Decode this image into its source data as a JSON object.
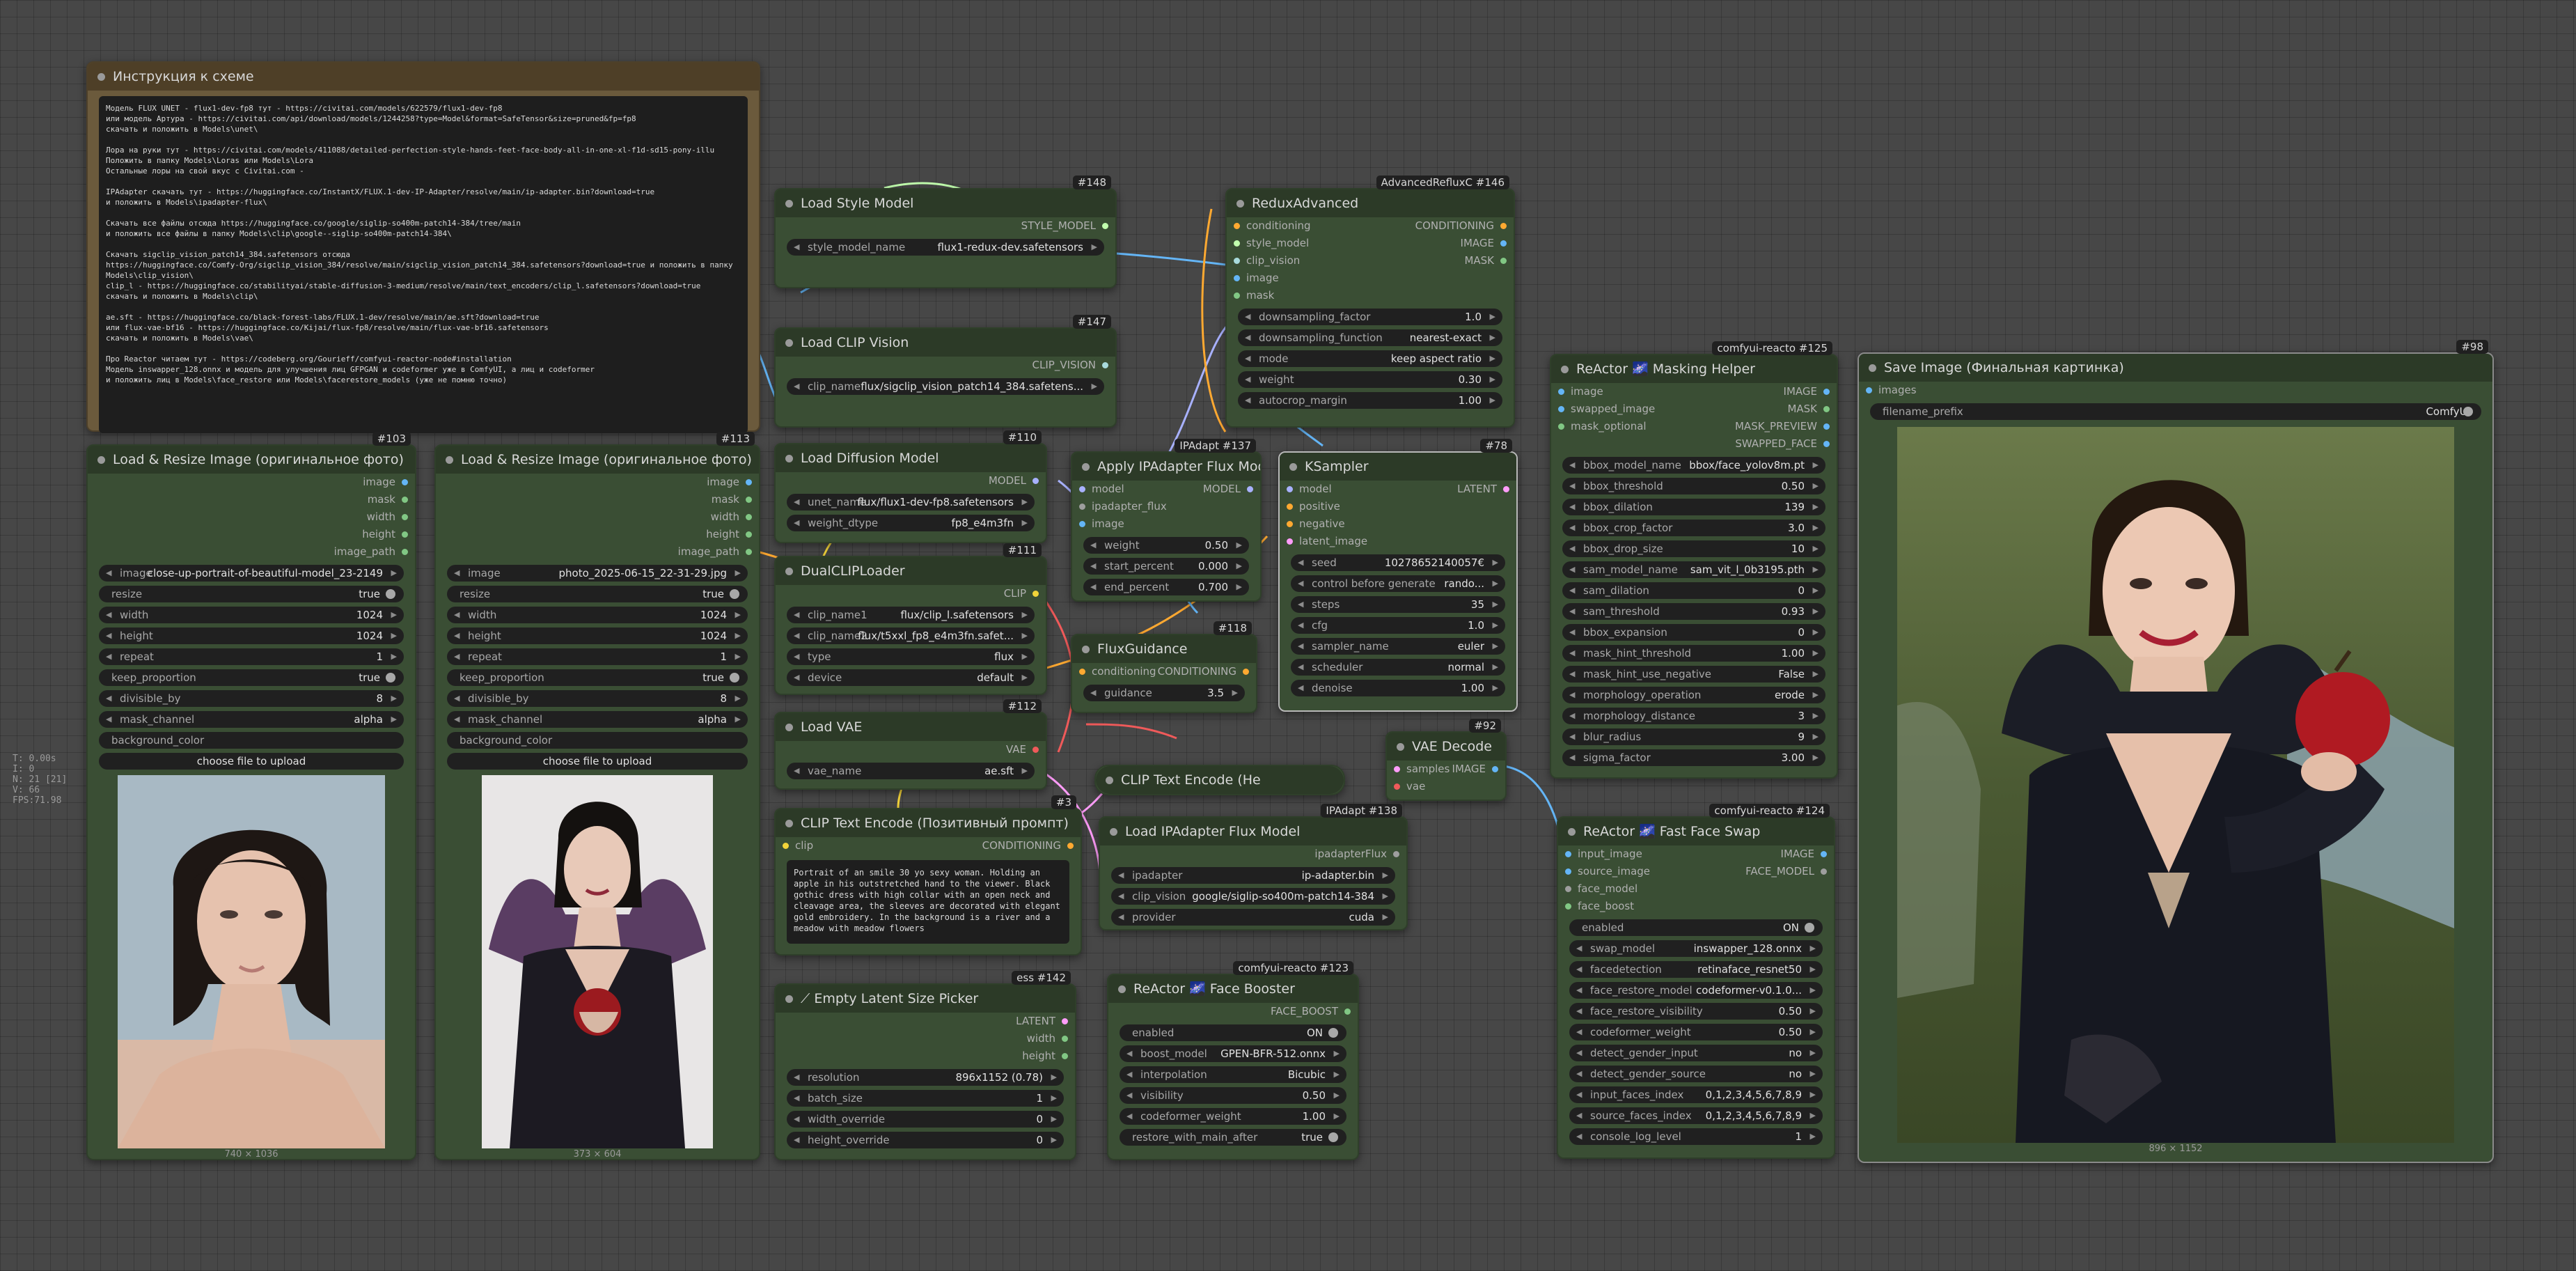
{
  "stats": [
    "T: 0.00s",
    "I: 0",
    "N: 21 [21]",
    "V: 66",
    "FPS:71.98"
  ],
  "colors": {
    "background": "#474747",
    "node_body": "#3a4e34",
    "node_title": "#2c3a27",
    "note_body": "#6b5a3c",
    "clip": "#f2d33a",
    "vae": "#ef5a5a",
    "model": "#a8b1ff",
    "conditioning": "#ffa931",
    "image": "#64b5f6",
    "mask": "#81c784",
    "latent": "#ff9cf9",
    "style_model": "#c2ffae"
  },
  "note": {
    "title": "Инструкция к схеме",
    "text": "Модель FLUX UNET - flux1-dev-fp8 тут - https://civitai.com/models/622579/flux1-dev-fp8\nили модель Артура - https://civitai.com/api/download/models/1244258?type=Model&format=SafeTensor&size=pruned&fp=fp8\nскачать и положить в Models\\unet\\\n\nЛора на руки тут - https://civitai.com/models/411088/detailed-perfection-style-hands-feet-face-body-all-in-one-xl-f1d-sd15-pony-illu\nПоложить в папку Models\\Loras или Models\\Lora\nОстальные лоры на свой вкус с Civitai.com -\n\nIPAdapter скачать тут - https://huggingface.co/InstantX/FLUX.1-dev-IP-Adapter/resolve/main/ip-adapter.bin?download=true\nи положить в Models\\ipadapter-flux\\\n\nСкачать все файлы отсюда https://huggingface.co/google/siglip-so400m-patch14-384/tree/main\nи положить все файлы в папку Models\\clip\\google--siglip-so400m-patch14-384\\\n\nСкачать sigclip_vision_patch14_384.safetensors отсюда\nhttps://huggingface.co/Comfy-Org/sigclip_vision_384/resolve/main/sigclip_vision_patch14_384.safetensors?download=true и положить в папку\nModels\\clip_vision\\\nclip_l - https://huggingface.co/stabilityai/stable-diffusion-3-medium/resolve/main/text_encoders/clip_l.safetensors?download=true\nскачать и положить в Models\\clip\\\n\nae.sft - https://huggingface.co/black-forest-labs/FLUX.1-dev/resolve/main/ae.sft?download=true\nили flux-vae-bf16 - https://huggingface.co/Kijai/flux-fp8/resolve/main/flux-vae-bf16.safetensors\nскачать и положить в Models\\vae\\\n\nПро Reactor читаем тут - https://codeberg.org/Gourieff/comfyui-reactor-node#installation\nМодель inswapper_128.onnx и модель для улучшения лиц GFPGAN и codeformer уже в ComfyUI, а лиц и codeformer\nи положить лиц в Models\\face_restore или Models\\facerestore_models (уже не помню точно)"
  },
  "load_resize_1": {
    "title": "Load & Resize Image (оригинальное фото)",
    "badge": "#103",
    "outputs": [
      "image",
      "mask",
      "width",
      "height",
      "image_path"
    ],
    "image": "close-up-portrait-of-beautiful-model_23-2149",
    "resize": "true",
    "width": "1024",
    "height": "1024",
    "repeat": "1",
    "keep_proportion": "true",
    "divisible_by": "8",
    "mask_channel": "alpha",
    "background_color": "background_color",
    "upload": "choose file to upload",
    "size_caption": "740 × 1036"
  },
  "load_resize_2": {
    "title": "Load & Resize Image (оригинальное фото)",
    "badge": "#113",
    "outputs": [
      "image",
      "mask",
      "width",
      "height",
      "image_path"
    ],
    "image": "photo_2025-06-15_22-31-29.jpg",
    "resize": "true",
    "width": "1024",
    "height": "1024",
    "repeat": "1",
    "keep_proportion": "true",
    "divisible_by": "8",
    "mask_channel": "alpha",
    "background_color": "background_color",
    "upload": "choose file to upload",
    "size_caption": "373 × 604"
  },
  "style_model": {
    "title": "Load Style Model",
    "badge": "#148",
    "output": "STYLE_MODEL",
    "label": "style_model_name",
    "value": "flux1-redux-dev.safetensors"
  },
  "clip_vision": {
    "title": "Load CLIP Vision",
    "badge": "#147",
    "output": "CLIP_VISION",
    "label": "clip_name",
    "value": "flux/sigclip_vision_patch14_384.safetens..."
  },
  "diffusion": {
    "title": "Load Diffusion Model",
    "badge": "#110",
    "output": "MODEL",
    "unet_label": "unet_name",
    "unet_value": "flux/flux1-dev-fp8.safetensors",
    "dtype_label": "weight_dtype",
    "dtype_value": "fp8_e4m3fn"
  },
  "dualclip": {
    "title": "DualCLIPLoader",
    "badge": "#111",
    "output": "CLIP",
    "clip1": "flux/clip_l.safetensors",
    "clip2": "flux/t5xxl_fp8_e4m3fn.safet...",
    "type": "flux",
    "device": "default"
  },
  "vae_loader": {
    "title": "Load VAE",
    "badge": "#112",
    "output": "VAE",
    "label": "vae_name",
    "value": "ae.sft"
  },
  "clip_text_pos": {
    "title": "CLIP Text Encode (Позитивный промпт)",
    "badge": "#3",
    "input": "clip",
    "output": "CONDITIONING",
    "text": "Portrait of an smile 30 yo sexy woman. Holding an apple in his outstretched hand to the viewer. Black gothic dress with high collar with an open neck and cleavage area, the sleeves are decorated with elegant gold embroidery. In the background is a river and a meadow with meadow flowers"
  },
  "latent_picker": {
    "title": "Empty Latent Size Picker",
    "badge": "#142",
    "badge_extra": "ess",
    "outputs": [
      "LATENT",
      "width",
      "height"
    ],
    "resolution": "896x1152 (0.78)",
    "batch_size": "1",
    "width_override": "0",
    "height_override": "0"
  },
  "redux": {
    "title": "ReduxAdvanced",
    "badge": "#146",
    "badge_extra": "AdvancedRefluxC",
    "inputs": [
      "conditioning",
      "style_model",
      "clip_vision",
      "image",
      "mask"
    ],
    "outputs": [
      "CONDITIONING",
      "IMAGE",
      "MASK"
    ],
    "downsampling_factor": "1.0",
    "downsampling_function": "nearest-exact",
    "mode": "keep aspect ratio",
    "weight": "0.30",
    "autocrop_margin": "1.00"
  },
  "apply_ipadapter": {
    "title": "Apply IPAdapter Flux Model",
    "badge": "#137",
    "badge_extra": "IPAdapt",
    "inputs": [
      "model",
      "ipadapter_flux",
      "image"
    ],
    "output": "MODEL",
    "weight": "0.50",
    "start_percent": "0.000",
    "end_percent": "0.700"
  },
  "flux_guidance": {
    "title": "FluxGuidance",
    "badge": "#118",
    "input": "conditioning",
    "output": "CONDITIONING",
    "guidance": "3.5"
  },
  "ksampler": {
    "title": "KSampler",
    "badge": "#78",
    "inputs": [
      "model",
      "positive",
      "negative",
      "latent_image"
    ],
    "output": "LATENT",
    "seed": "10278652140057€",
    "control": "rando...",
    "steps": "35",
    "cfg": "1.0",
    "sampler_name": "euler",
    "scheduler": "normal",
    "denoise": "1.00"
  },
  "vae_decode": {
    "title": "VAE Decode",
    "badge": "#92",
    "inputs": [
      "samples",
      "vae"
    ],
    "output": "IMAGE"
  },
  "clip_text_he": {
    "title": "CLIP Text Encode (He"
  },
  "load_ipadapter": {
    "title": "Load IPAdapter Flux Model",
    "badge": "#138",
    "badge_extra": "IPAdapt",
    "output": "ipadapterFlux",
    "ipadapter": "ip-adapter.bin",
    "clip_vision": "google/siglip-so400m-patch14-384",
    "provider": "cuda"
  },
  "face_booster": {
    "title": "ReActor 🌌 Face Booster",
    "badge": "#123",
    "badge_extra": "comfyui-reacto",
    "output": "FACE_BOOST",
    "enabled": "ON",
    "boost_model": "GPEN-BFR-512.onnx",
    "interpolation": "Bicubic",
    "visibility": "0.50",
    "codeformer_weight": "1.00",
    "restore_with_main_after": "true"
  },
  "masking_helper": {
    "title": "ReActor 🌌 Masking Helper",
    "badge": "#125",
    "badge_extra": "comfyui-reacto",
    "inputs": [
      "image",
      "swapped_image",
      "mask_optional"
    ],
    "outputs": [
      "IMAGE",
      "MASK",
      "MASK_PREVIEW",
      "SWAPPED_FACE"
    ],
    "rows": [
      [
        "bbox_model_name",
        "bbox/face_yolov8m.pt"
      ],
      [
        "bbox_threshold",
        "0.50"
      ],
      [
        "bbox_dilation",
        "139"
      ],
      [
        "bbox_crop_factor",
        "3.0"
      ],
      [
        "bbox_drop_size",
        "10"
      ],
      [
        "sam_model_name",
        "sam_vit_l_0b3195.pth"
      ],
      [
        "sam_dilation",
        "0"
      ],
      [
        "sam_threshold",
        "0.93"
      ],
      [
        "bbox_expansion",
        "0"
      ],
      [
        "mask_hint_threshold",
        "1.00"
      ],
      [
        "mask_hint_use_negative",
        "False"
      ],
      [
        "morphology_operation",
        "erode"
      ],
      [
        "morphology_distance",
        "3"
      ],
      [
        "blur_radius",
        "9"
      ],
      [
        "sigma_factor",
        "3.00"
      ]
    ]
  },
  "fast_face_swap": {
    "title": "ReActor 🌌 Fast Face Swap",
    "badge": "#124",
    "badge_extra": "comfyui-reacto",
    "inputs": [
      "input_image",
      "source_image",
      "face_model",
      "face_boost"
    ],
    "outputs": [
      "IMAGE",
      "FACE_MODEL"
    ],
    "enabled": "ON",
    "rows": [
      [
        "swap_model",
        "inswapper_128.onnx"
      ],
      [
        "facedetection",
        "retinaface_resnet50"
      ],
      [
        "face_restore_model",
        "codeformer-v0.1.0..."
      ],
      [
        "face_restore_visibility",
        "0.50"
      ],
      [
        "codeformer_weight",
        "0.50"
      ],
      [
        "detect_gender_input",
        "no"
      ],
      [
        "detect_gender_source",
        "no"
      ],
      [
        "input_faces_index",
        "0,1,2,3,4,5,6,7,8,9"
      ],
      [
        "source_faces_index",
        "0,1,2,3,4,5,6,7,8,9"
      ],
      [
        "console_log_level",
        "1"
      ]
    ]
  },
  "save_image": {
    "title": "Save Image (Финальная картинка)",
    "badge": "#98",
    "input": "images",
    "prefix_label": "filename_prefix",
    "prefix_value": "ComfyUI",
    "size_caption": "896 × 1152"
  }
}
